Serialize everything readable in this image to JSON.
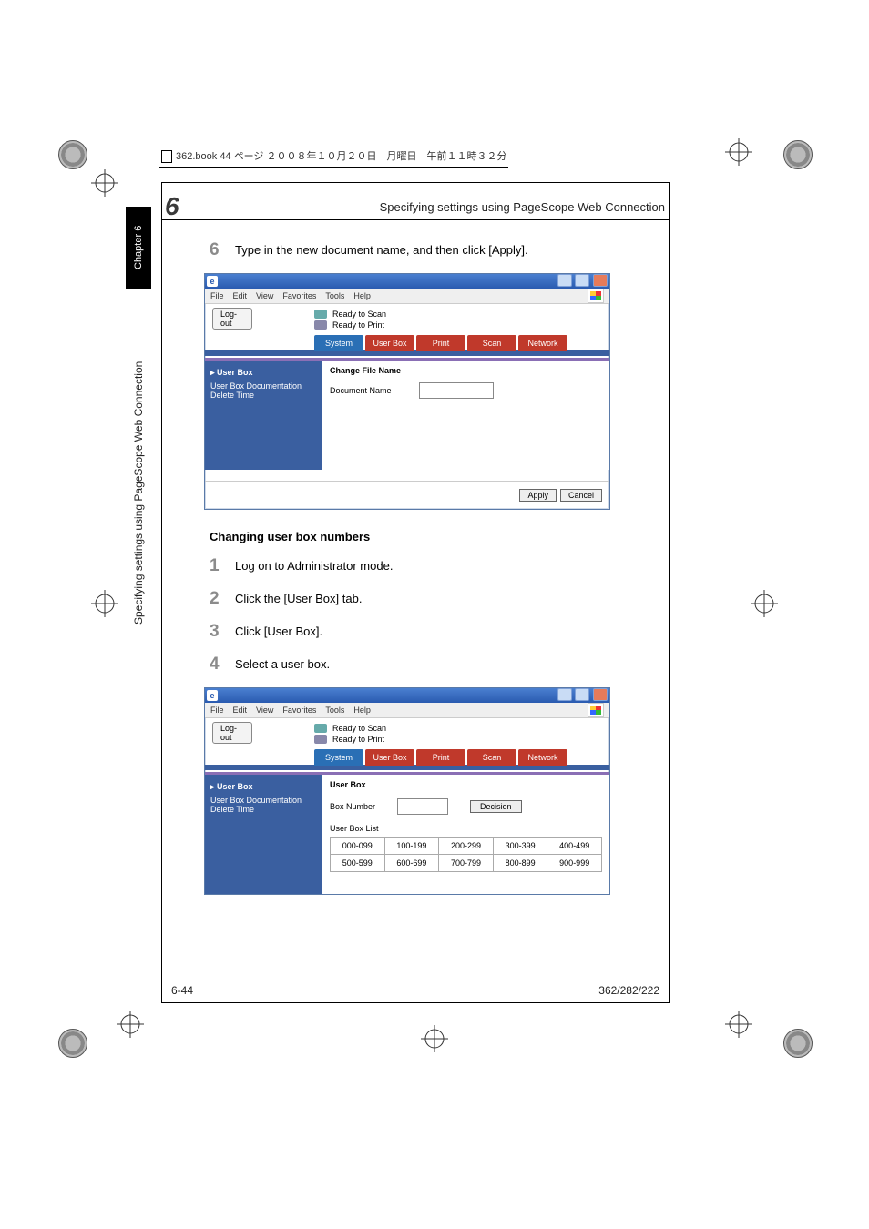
{
  "annot": "362.book  44 ページ  ２００８年１０月２０日　月曜日　午前１１時３２分",
  "chapter_num": "6",
  "running_title": "Specifying settings using PageScope Web Connection",
  "side_tab": "Chapter 6",
  "side_label": "Specifying settings using PageScope Web Connection",
  "step6": {
    "num": "6",
    "text": "Type in the new document name, and then click [Apply]."
  },
  "subhead": "Changing user box numbers",
  "steps": [
    {
      "num": "1",
      "text": "Log on to Administrator mode."
    },
    {
      "num": "2",
      "text": "Click the [User Box] tab."
    },
    {
      "num": "3",
      "text": "Click [User Box]."
    },
    {
      "num": "4",
      "text": "Select a user box."
    }
  ],
  "footer_left": "6-44",
  "footer_right": "362/282/222",
  "win_common": {
    "menus": [
      "File",
      "Edit",
      "View",
      "Favorites",
      "Tools",
      "Help"
    ],
    "status_scan": "Ready to Scan",
    "status_print": "Ready to Print",
    "logout": "Log-out",
    "tabs": [
      "System",
      "User Box",
      "Print",
      "Scan",
      "Network"
    ],
    "nav_main": "User Box",
    "nav_sub": "User Box Documentation Delete Time"
  },
  "win1": {
    "title": "Change File Name",
    "field_label": "Document Name",
    "apply": "Apply",
    "cancel": "Cancel"
  },
  "win2": {
    "title": "User Box",
    "boxnum_label": "Box Number",
    "decision": "Decision",
    "list_label": "User Box List",
    "ranges": [
      [
        "000-099",
        "100-199",
        "200-299",
        "300-399",
        "400-499"
      ],
      [
        "500-599",
        "600-699",
        "700-799",
        "800-899",
        "900-999"
      ]
    ]
  }
}
